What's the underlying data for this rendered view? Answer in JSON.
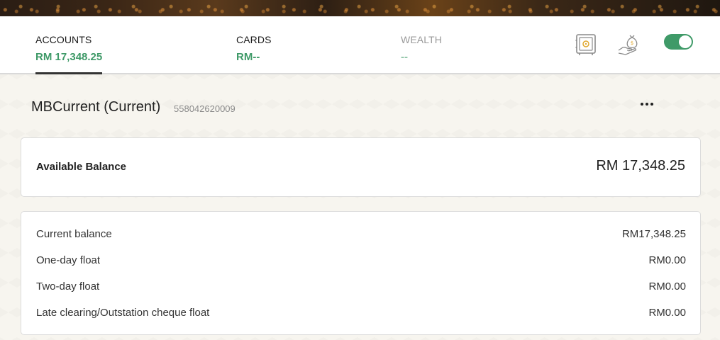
{
  "tabs": [
    {
      "label": "ACCOUNTS",
      "value": "RM 17,348.25",
      "active": true
    },
    {
      "label": "CARDS",
      "value": "RM--",
      "active": false
    },
    {
      "label": "WEALTH",
      "value": "--",
      "active": false
    }
  ],
  "header_icons": [
    "safe-icon",
    "money-bag-hand-icon"
  ],
  "toggle": {
    "state": "on",
    "color": "#3f9a68"
  },
  "account": {
    "name": "MBCurrent (Current)",
    "number": "558042620009"
  },
  "available_balance": {
    "label": "Available Balance",
    "value": "RM 17,348.25"
  },
  "balance_details": [
    {
      "label": "Current balance",
      "value": "RM17,348.25"
    },
    {
      "label": "One-day float",
      "value": "RM0.00"
    },
    {
      "label": "Two-day float",
      "value": "RM0.00"
    },
    {
      "label": "Late clearing/Outstation cheque float",
      "value": "RM0.00"
    }
  ],
  "colors": {
    "accent": "#3f9a68",
    "accent_muted": "#8fc4a6"
  }
}
